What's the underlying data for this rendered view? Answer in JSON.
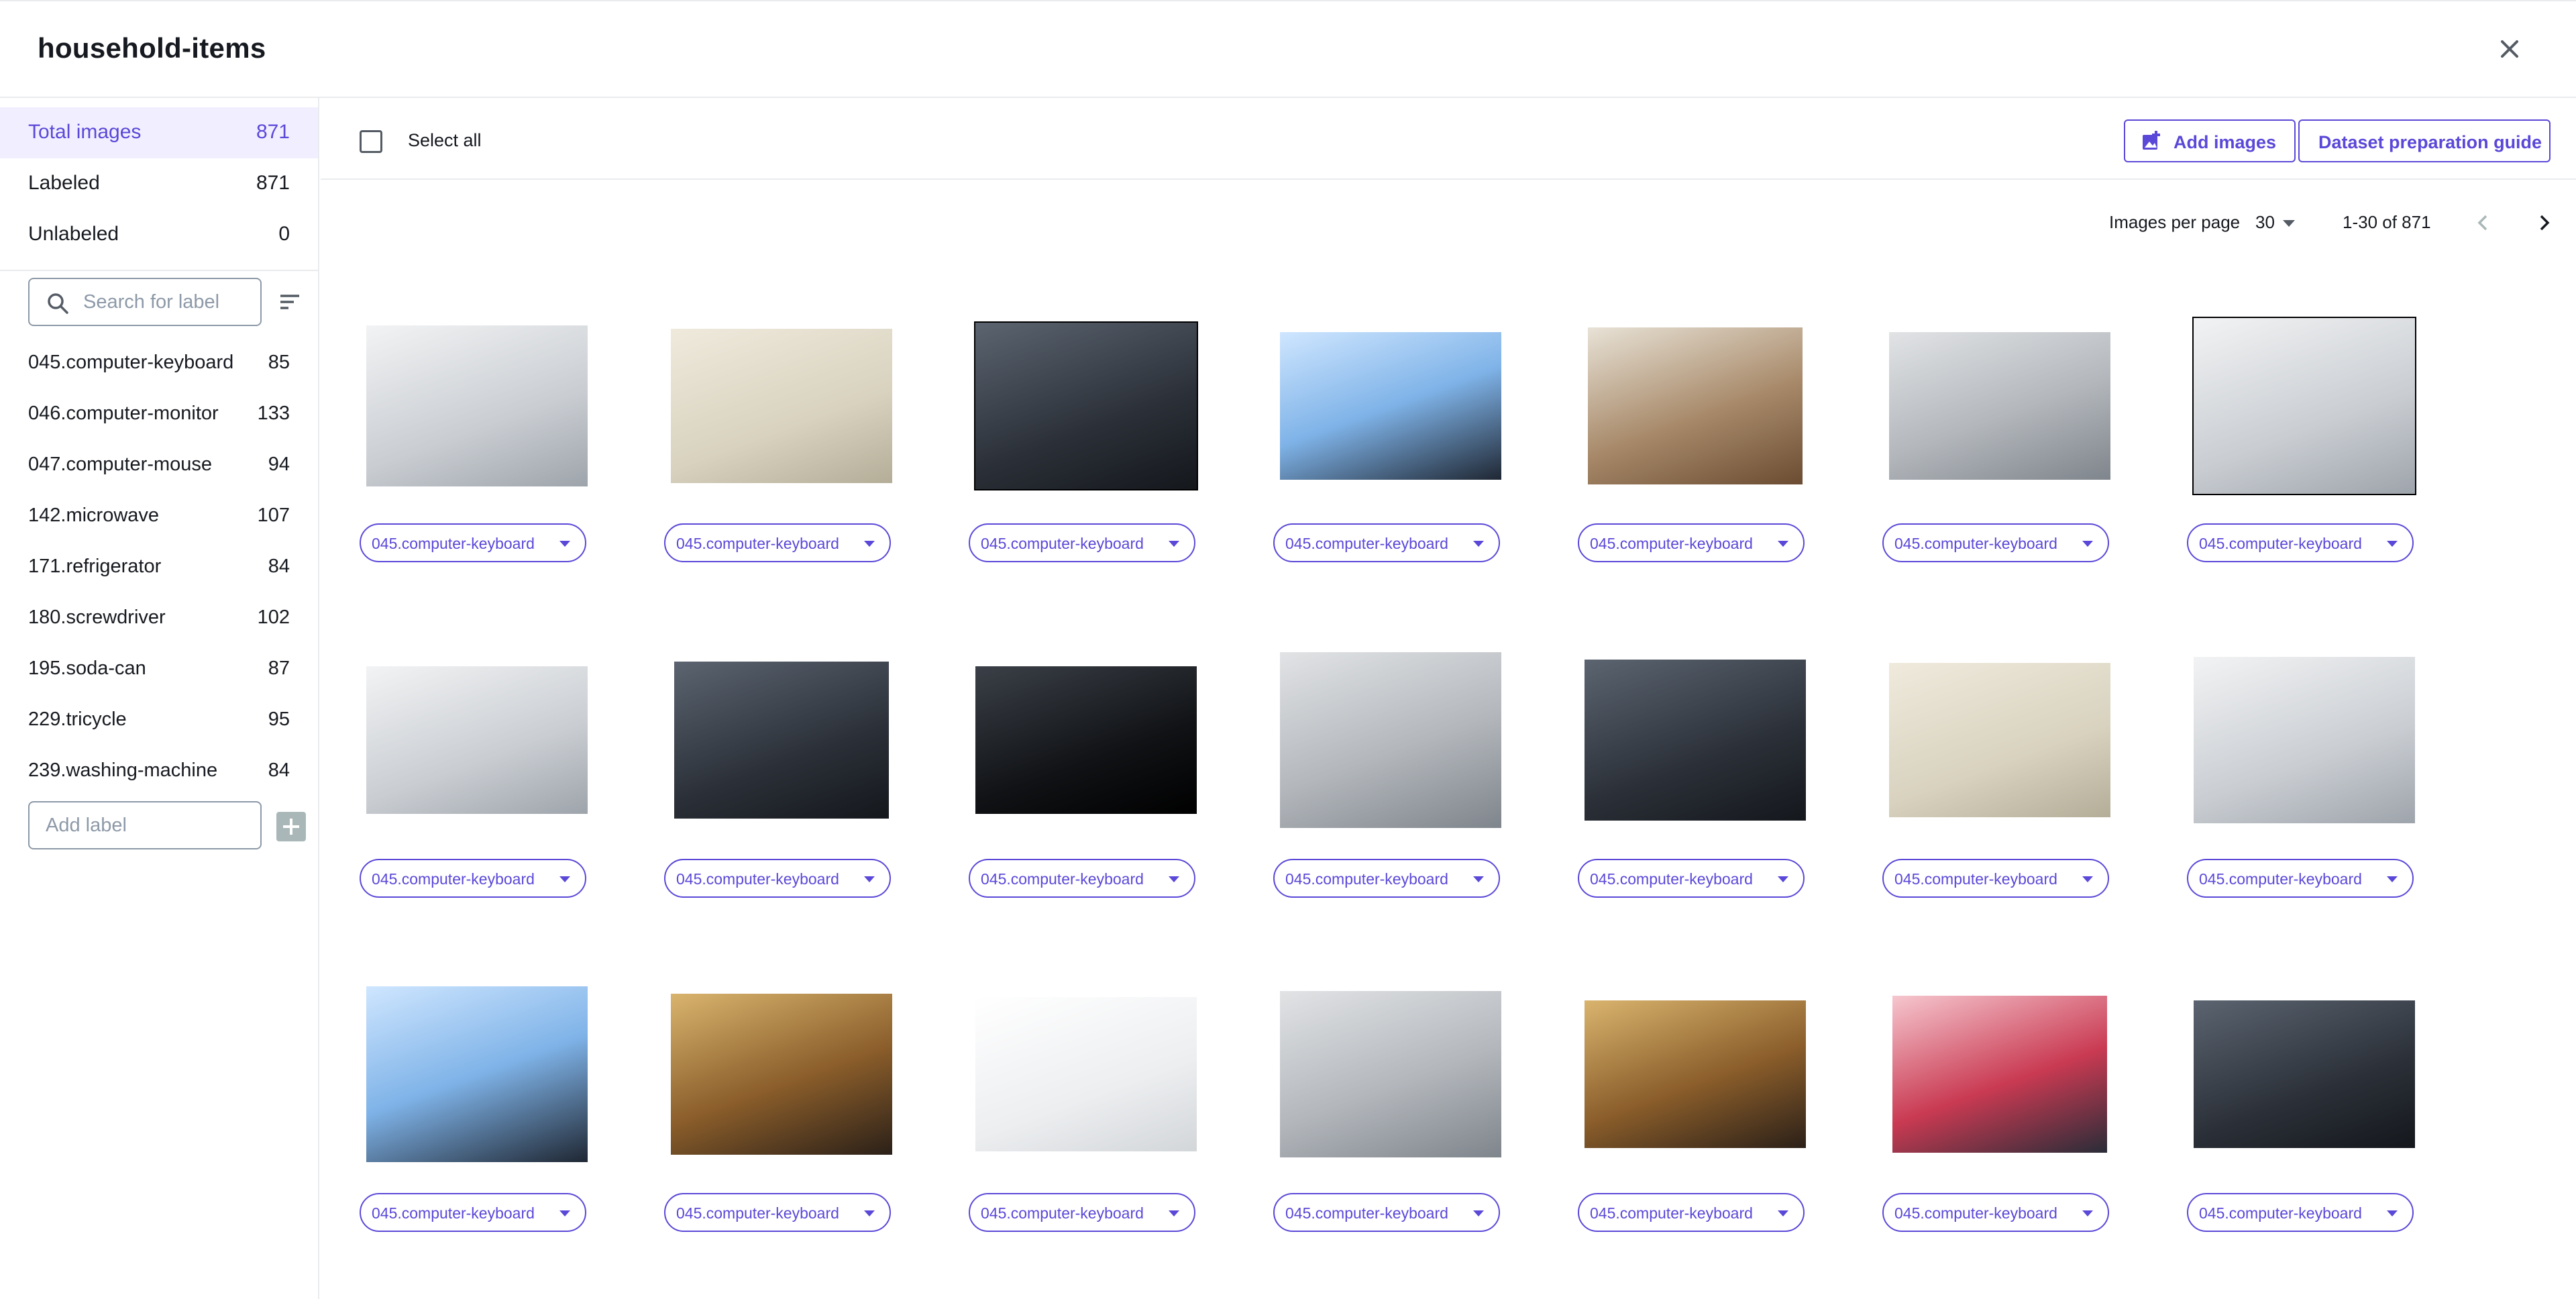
{
  "header": {
    "title": "household-items"
  },
  "sidebar": {
    "totals": [
      {
        "label": "Total images",
        "count": "871"
      },
      {
        "label": "Labeled",
        "count": "871"
      },
      {
        "label": "Unlabeled",
        "count": "0"
      }
    ],
    "search_placeholder": "Search for label",
    "labels": [
      {
        "name": "045.computer-keyboard",
        "count": "85"
      },
      {
        "name": "046.computer-monitor",
        "count": "133"
      },
      {
        "name": "047.computer-mouse",
        "count": "94"
      },
      {
        "name": "142.microwave",
        "count": "107"
      },
      {
        "name": "171.refrigerator",
        "count": "84"
      },
      {
        "name": "180.screwdriver",
        "count": "102"
      },
      {
        "name": "195.soda-can",
        "count": "87"
      },
      {
        "name": "229.tricycle",
        "count": "95"
      },
      {
        "name": "239.washing-machine",
        "count": "84"
      }
    ],
    "add_label_placeholder": "Add label"
  },
  "toolbar": {
    "select_all": "Select all",
    "add_images": "Add images",
    "guide": "Dataset preparation guide"
  },
  "pagination": {
    "per_page_label": "Images per page",
    "per_page_value": "30",
    "range": "1-30 of 871"
  },
  "images": {
    "label": "045.computer-keyboard",
    "rows": [
      [
        {
          "label": "045.computer-keyboard",
          "tone": "light"
        },
        {
          "label": "045.computer-keyboard",
          "tone": "beige"
        },
        {
          "label": "045.computer-keyboard",
          "tone": "dark",
          "selected": true
        },
        {
          "label": "045.computer-keyboard",
          "tone": "blue"
        },
        {
          "label": "045.computer-keyboard",
          "tone": "photo"
        },
        {
          "label": "045.computer-keyboard",
          "tone": "grey"
        },
        {
          "label": "045.computer-keyboard",
          "tone": "light",
          "selected": true
        }
      ],
      [
        {
          "label": "045.computer-keyboard",
          "tone": "light"
        },
        {
          "label": "045.computer-keyboard",
          "tone": "dark"
        },
        {
          "label": "045.computer-keyboard",
          "tone": "black"
        },
        {
          "label": "045.computer-keyboard",
          "tone": "grey"
        },
        {
          "label": "045.computer-keyboard",
          "tone": "dark"
        },
        {
          "label": "045.computer-keyboard",
          "tone": "beige"
        },
        {
          "label": "045.computer-keyboard",
          "tone": "light"
        }
      ],
      [
        {
          "label": "045.computer-keyboard",
          "tone": "blue"
        },
        {
          "label": "045.computer-keyboard",
          "tone": "brown"
        },
        {
          "label": "045.computer-keyboard",
          "tone": "white"
        },
        {
          "label": "045.computer-keyboard",
          "tone": "grey"
        },
        {
          "label": "045.computer-keyboard",
          "tone": "brown"
        },
        {
          "label": "045.computer-keyboard",
          "tone": "red"
        },
        {
          "label": "045.computer-keyboard",
          "tone": "dark"
        }
      ]
    ]
  },
  "colors": {
    "accent": "#5a48d8",
    "active_bg": "#f1efff",
    "border": "#e9ebed"
  },
  "icons": [
    "close-icon",
    "search-icon",
    "sort-icon",
    "add-image-icon",
    "chevron-left-icon",
    "chevron-right-icon",
    "caret-down-icon"
  ]
}
